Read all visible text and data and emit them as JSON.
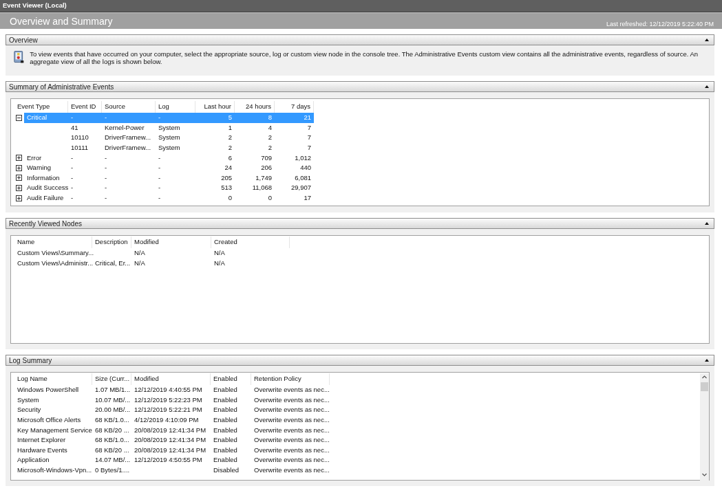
{
  "window": {
    "title": "Event Viewer (Local)"
  },
  "header": {
    "title": "Overview and Summary",
    "last_refreshed": "Last refreshed: 12/12/2019 5:22:40 PM"
  },
  "overview": {
    "title": "Overview",
    "text": "To view events that have occurred on your computer, select the appropriate source, log or custom view node in the console tree. The Administrative Events custom view contains all the administrative events, regardless of source. An aggregate view of all the logs is shown below."
  },
  "summary": {
    "title": "Summary of Administrative Events",
    "columns": [
      "Event Type",
      "Event ID",
      "Source",
      "Log",
      "Last hour",
      "24 hours",
      "7 days"
    ],
    "rows": [
      {
        "cells": [
          "Critical",
          "-",
          "-",
          "-",
          "5",
          "8",
          "21"
        ],
        "selected": true,
        "expanded": true,
        "children": [
          {
            "cells": [
              "41",
              "Kernel-Power",
              "System",
              "1",
              "4",
              "7"
            ]
          },
          {
            "cells": [
              "10110",
              "DriverFramew...",
              "System",
              "2",
              "2",
              "7"
            ]
          },
          {
            "cells": [
              "10111",
              "DriverFramew...",
              "System",
              "2",
              "2",
              "7"
            ]
          }
        ]
      },
      {
        "cells": [
          "Error",
          "-",
          "-",
          "-",
          "6",
          "709",
          "1,012"
        ],
        "selected": false,
        "expanded": false
      },
      {
        "cells": [
          "Warning",
          "-",
          "-",
          "-",
          "24",
          "206",
          "440"
        ],
        "selected": false,
        "expanded": false
      },
      {
        "cells": [
          "Information",
          "-",
          "-",
          "-",
          "205",
          "1,749",
          "6,081"
        ],
        "selected": false,
        "expanded": false
      },
      {
        "cells": [
          "Audit Success",
          "-",
          "-",
          "-",
          "513",
          "11,068",
          "29,907"
        ],
        "selected": false,
        "expanded": false
      },
      {
        "cells": [
          "Audit Failure",
          "-",
          "-",
          "-",
          "0",
          "0",
          "17"
        ],
        "selected": false,
        "expanded": false
      }
    ]
  },
  "recent": {
    "title": "Recently Viewed Nodes",
    "columns": [
      "Name",
      "Description",
      "Modified",
      "Created"
    ],
    "rows": [
      [
        "Custom Views\\Summary...",
        "",
        "N/A",
        "N/A"
      ],
      [
        "Custom Views\\Administr...",
        "Critical, Er...",
        "N/A",
        "N/A"
      ]
    ]
  },
  "logs": {
    "title": "Log Summary",
    "columns": [
      "Log Name",
      "Size (Curr...",
      "Modified",
      "Enabled",
      "Retention Policy"
    ],
    "rows": [
      [
        "Windows PowerShell",
        "1.07 MB/1...",
        "12/12/2019 4:40:55 PM",
        "Enabled",
        "Overwrite events as nec..."
      ],
      [
        "System",
        "10.07 MB/...",
        "12/12/2019 5:22:23 PM",
        "Enabled",
        "Overwrite events as nec..."
      ],
      [
        "Security",
        "20.00 MB/...",
        "12/12/2019 5:22:21 PM",
        "Enabled",
        "Overwrite events as nec..."
      ],
      [
        "Microsoft Office Alerts",
        "68 KB/1.0...",
        "4/12/2019 4:10:09 PM",
        "Enabled",
        "Overwrite events as nec..."
      ],
      [
        "Key Management Service",
        "68 KB/20 ...",
        "20/08/2019 12:41:34 PM",
        "Enabled",
        "Overwrite events as nec..."
      ],
      [
        "Internet Explorer",
        "68 KB/1.0...",
        "20/08/2019 12:41:34 PM",
        "Enabled",
        "Overwrite events as nec..."
      ],
      [
        "Hardware Events",
        "68 KB/20 ...",
        "20/08/2019 12:41:34 PM",
        "Enabled",
        "Overwrite events as nec..."
      ],
      [
        "Application",
        "14.07 MB/...",
        "12/12/2019 4:50:55 PM",
        "Enabled",
        "Overwrite events as nec..."
      ],
      [
        "Microsoft-Windows-Vpn...",
        "0 Bytes/1....",
        "",
        "Disabled",
        "Overwrite events as nec..."
      ]
    ]
  }
}
